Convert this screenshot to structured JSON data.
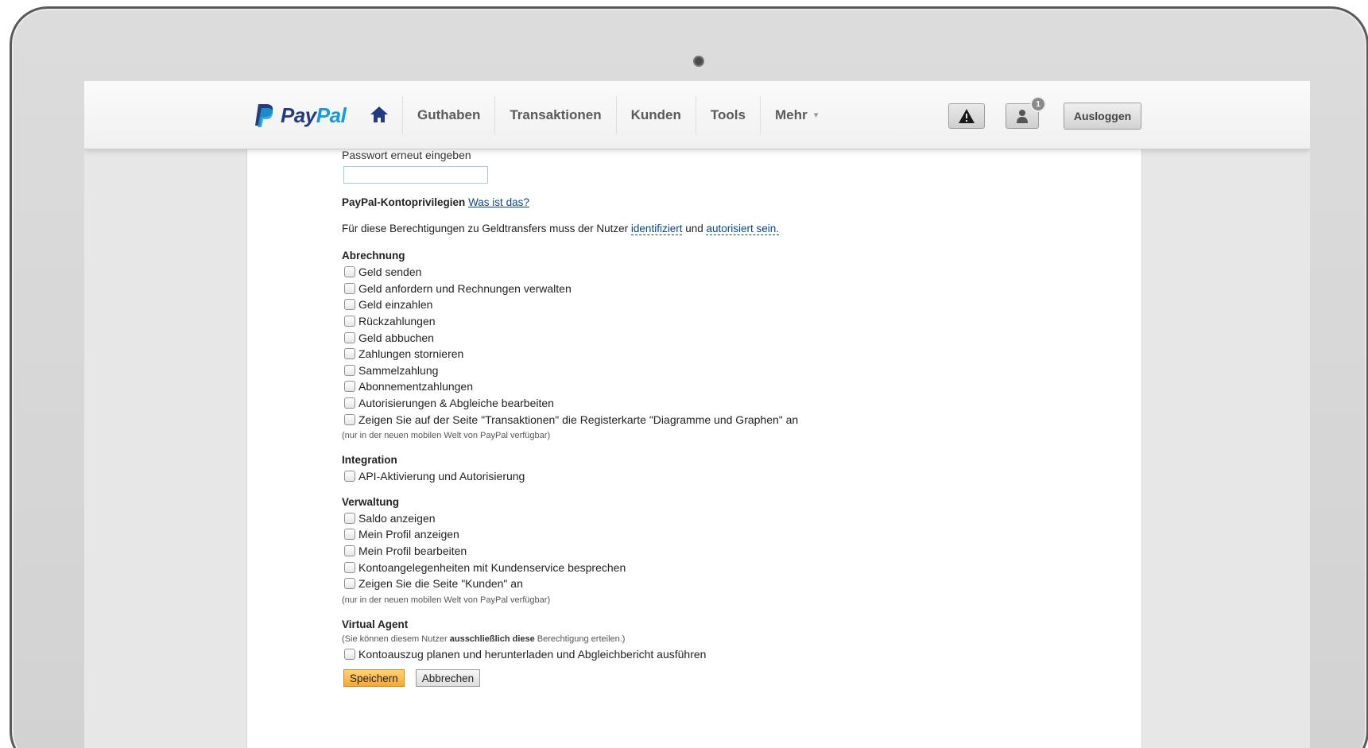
{
  "header": {
    "logo_text_1": "Pay",
    "logo_text_2": "Pal",
    "nav": [
      {
        "label": "Guthaben"
      },
      {
        "label": "Transaktionen"
      },
      {
        "label": "Kunden"
      },
      {
        "label": "Tools"
      },
      {
        "label": "Mehr",
        "caret": "▼"
      }
    ],
    "notifications_badge": "1",
    "logout_label": "Ausloggen"
  },
  "form": {
    "password_repeat_label": "Passwort erneut eingeben",
    "password_repeat_value": "",
    "privileges_title": "PayPal-Kontoprivilegien",
    "privileges_link": "Was ist das?",
    "intro_text": "Für diese Berechtigungen zu Geldtransfers muss der Nutzer ",
    "intro_link_1": "identifiziert",
    "intro_middle": " und ",
    "intro_link_2": "autorisiert sein.",
    "sections": {
      "billing": {
        "title": "Abrechnung",
        "items": [
          "Geld senden",
          "Geld anfordern und Rechnungen verwalten",
          "Geld einzahlen",
          "Rückzahlungen",
          "Geld abbuchen",
          "Zahlungen stornieren",
          "Sammelzahlung",
          "Abonnementzahlungen",
          "Autorisierungen & Abgleiche bearbeiten",
          "Zeigen Sie auf der Seite \"Transaktionen\" die Registerkarte \"Diagramme und Graphen\" an"
        ],
        "note": "(nur in der neuen mobilen Welt von PayPal verfügbar)"
      },
      "integration": {
        "title": "Integration",
        "items": [
          "API-Aktivierung und Autorisierung"
        ]
      },
      "administration": {
        "title": "Verwaltung",
        "items": [
          "Saldo anzeigen",
          "Mein Profil anzeigen",
          "Mein Profil bearbeiten",
          "Kontoangelegenheiten mit Kundenservice besprechen",
          "Zeigen Sie die Seite \"Kunden\" an"
        ],
        "note": "(nur in der neuen mobilen Welt von PayPal verfügbar)"
      },
      "virtual_agent": {
        "title": "Virtual Agent",
        "note_prefix": "(Sie können diesem Nutzer ",
        "note_bold": "ausschließlich diese",
        "note_suffix": " Berechtigung erteilen.)",
        "items": [
          "Kontoauszug planen und herunterladen und Abgleichbericht ausführen"
        ]
      }
    },
    "save_label": "Speichern",
    "cancel_label": "Abbrechen"
  },
  "colors": {
    "paypal_dark_blue": "#253b80",
    "paypal_light_blue": "#179bd7",
    "link_blue": "#084688",
    "save_orange": "#f8a830"
  },
  "icons": [
    "paypal-logo-icon",
    "home-icon",
    "warning-icon",
    "user-icon"
  ]
}
